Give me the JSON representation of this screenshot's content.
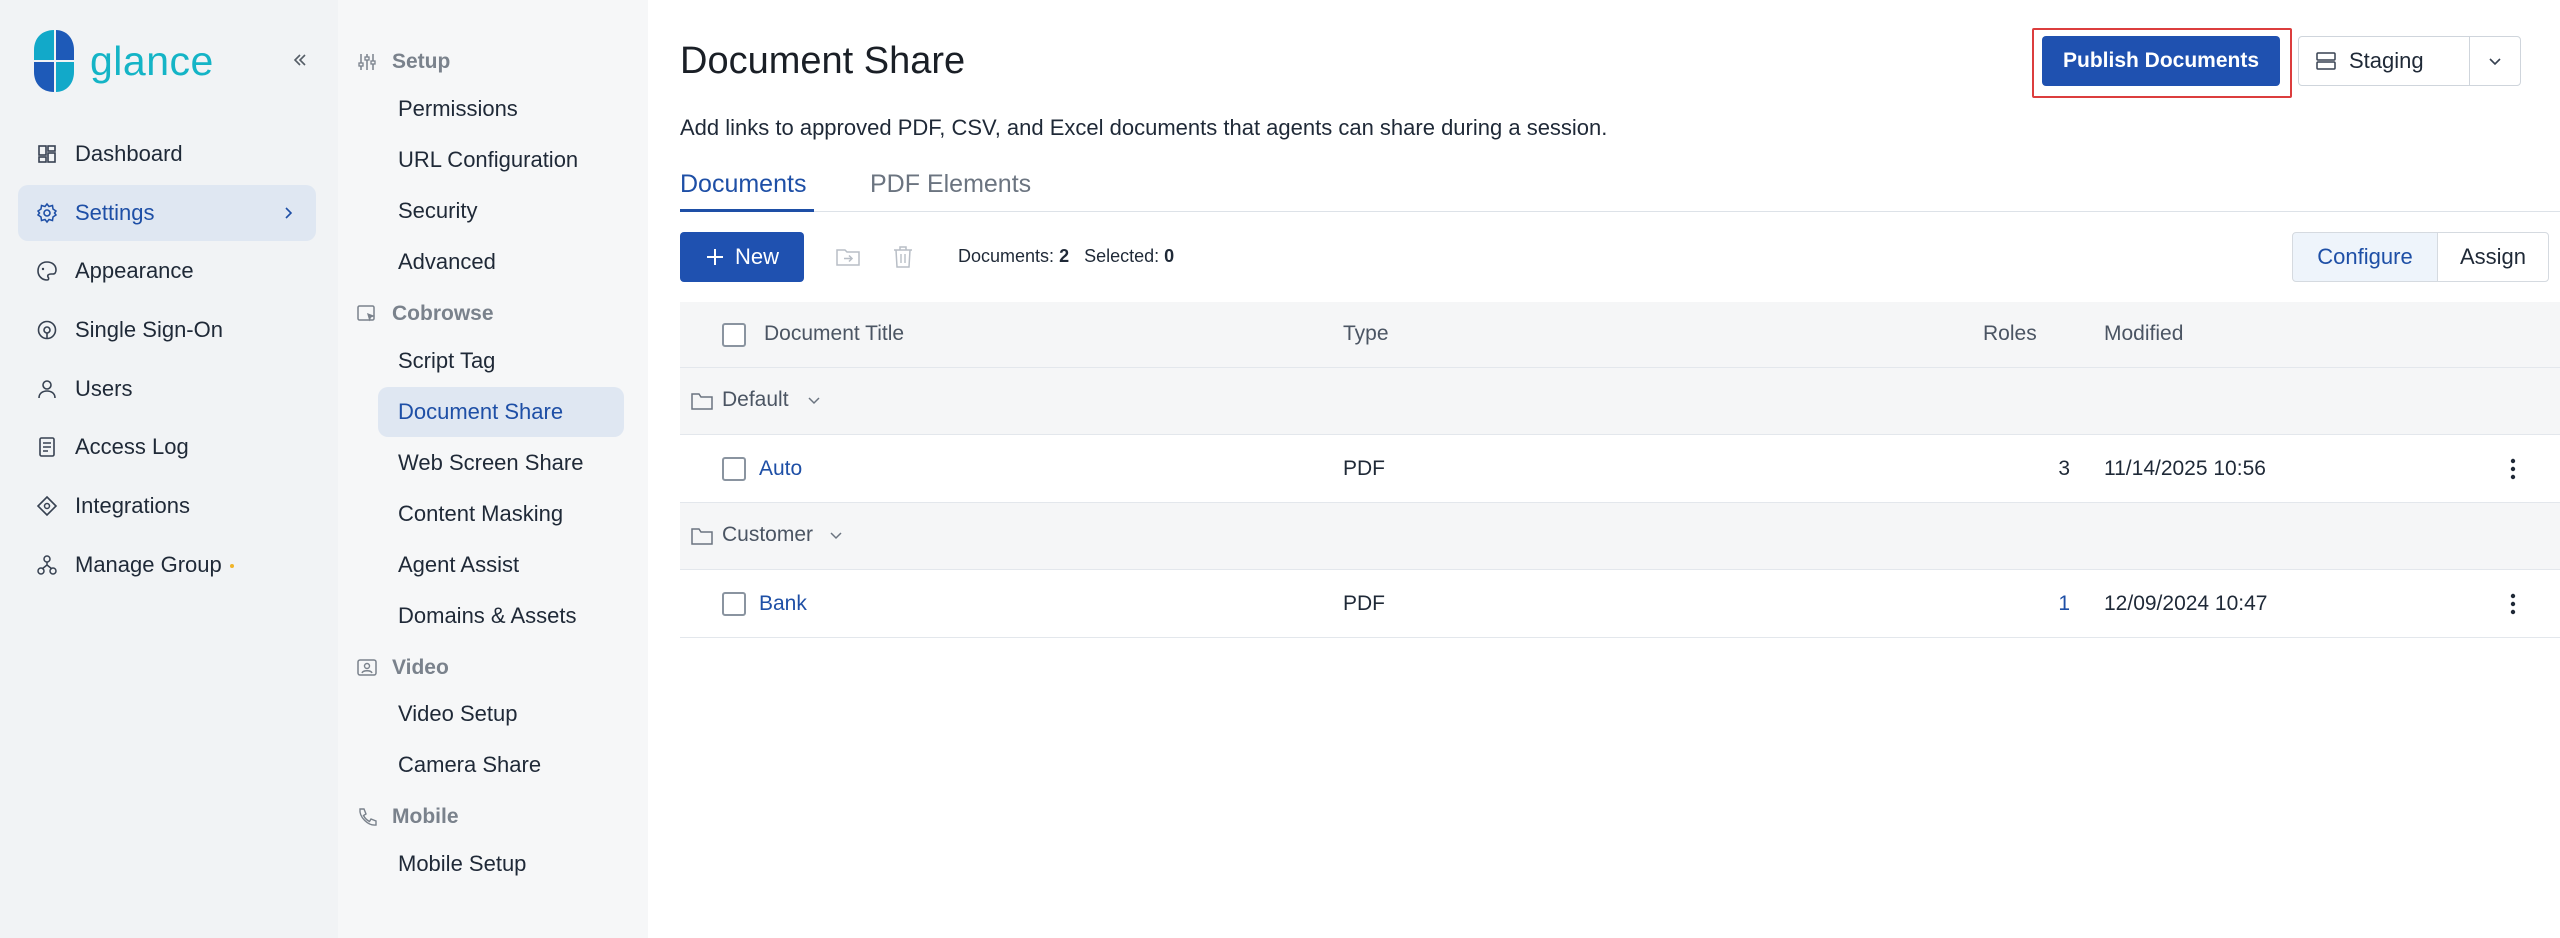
{
  "brand": {
    "name": "glance"
  },
  "nav": {
    "items": [
      {
        "label": "Dashboard",
        "icon": "dashboard-icon"
      },
      {
        "label": "Settings",
        "icon": "gear-icon",
        "active": true
      },
      {
        "label": "Appearance",
        "icon": "palette-icon"
      },
      {
        "label": "Single Sign-On",
        "icon": "sso-icon"
      },
      {
        "label": "Users",
        "icon": "user-icon"
      },
      {
        "label": "Access Log",
        "icon": "log-icon"
      },
      {
        "label": "Integrations",
        "icon": "integrations-icon"
      },
      {
        "label": "Manage Group",
        "icon": "group-icon"
      }
    ]
  },
  "subnav": {
    "sections": [
      {
        "title": "Setup",
        "icon": "sliders-icon",
        "items": [
          "Permissions",
          "URL Configuration",
          "Security",
          "Advanced"
        ]
      },
      {
        "title": "Cobrowse",
        "icon": "cobrowse-icon",
        "items": [
          "Script Tag",
          "Document Share",
          "Web Screen Share",
          "Content Masking",
          "Agent Assist",
          "Domains & Assets"
        ]
      },
      {
        "title": "Video",
        "icon": "video-icon",
        "items": [
          "Video Setup",
          "Camera Share"
        ]
      },
      {
        "title": "Mobile",
        "icon": "phone-icon",
        "items": [
          "Mobile Setup"
        ]
      }
    ],
    "active": "Document Share"
  },
  "page": {
    "title": "Document Share",
    "subtitle": "Add links to approved PDF, CSV, and Excel documents that agents can share during a session.",
    "publish_label": "Publish Documents",
    "environment": "Staging"
  },
  "tabs": [
    {
      "label": "Documents",
      "active": true
    },
    {
      "label": "PDF Elements",
      "active": false
    }
  ],
  "toolbar": {
    "new_label": "New",
    "documents_label": "Documents:",
    "documents_count": "2",
    "selected_label": "Selected:",
    "selected_count": "0",
    "configure_label": "Configure",
    "assign_label": "Assign"
  },
  "table": {
    "columns": [
      "Document Title",
      "Type",
      "Roles",
      "Modified"
    ],
    "groups": [
      {
        "name": "Default",
        "docs": [
          {
            "title": "Auto",
            "type": "PDF",
            "roles": "3",
            "modified": "11/14/2025 10:56"
          }
        ]
      },
      {
        "name": "Customer",
        "docs": [
          {
            "title": "Bank",
            "type": "PDF",
            "roles": "1",
            "modified": "12/09/2024 10:47"
          }
        ]
      }
    ]
  },
  "colors": {
    "primary": "#1f51b0",
    "brand": "#14b4c6",
    "highlight_border": "#dc3d3d",
    "active_nav_bg": "#dfe7f2"
  }
}
